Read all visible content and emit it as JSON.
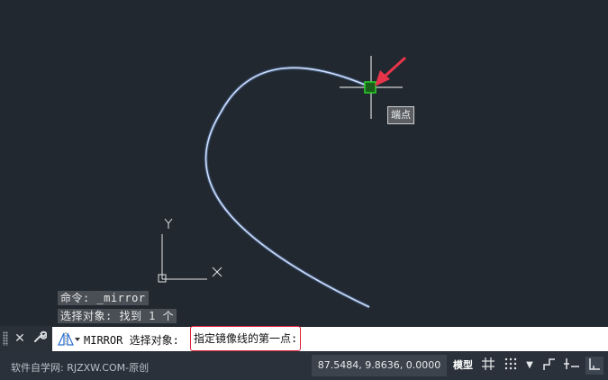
{
  "canvas": {
    "ucs_y_label": "Y",
    "ucs_x_label": "X",
    "snap_tooltip": "端点",
    "curve_color": "#a8c8ff",
    "snap_marker_color": "#2bd12b",
    "arrow_color": "#e8344a"
  },
  "history": [
    "命令: _mirror",
    "选择对象: 找到 1 个"
  ],
  "command_line": {
    "prefix": "MIRROR 选择对象:",
    "prompt": "指定镜像线的第一点:",
    "prompt_border_color": "#e0223a"
  },
  "status": {
    "watermark": "软件自学网: RJZXW.COM-原创",
    "coordinates": "87.5484, 9.8636, 0.0000",
    "model_label": "模型"
  }
}
